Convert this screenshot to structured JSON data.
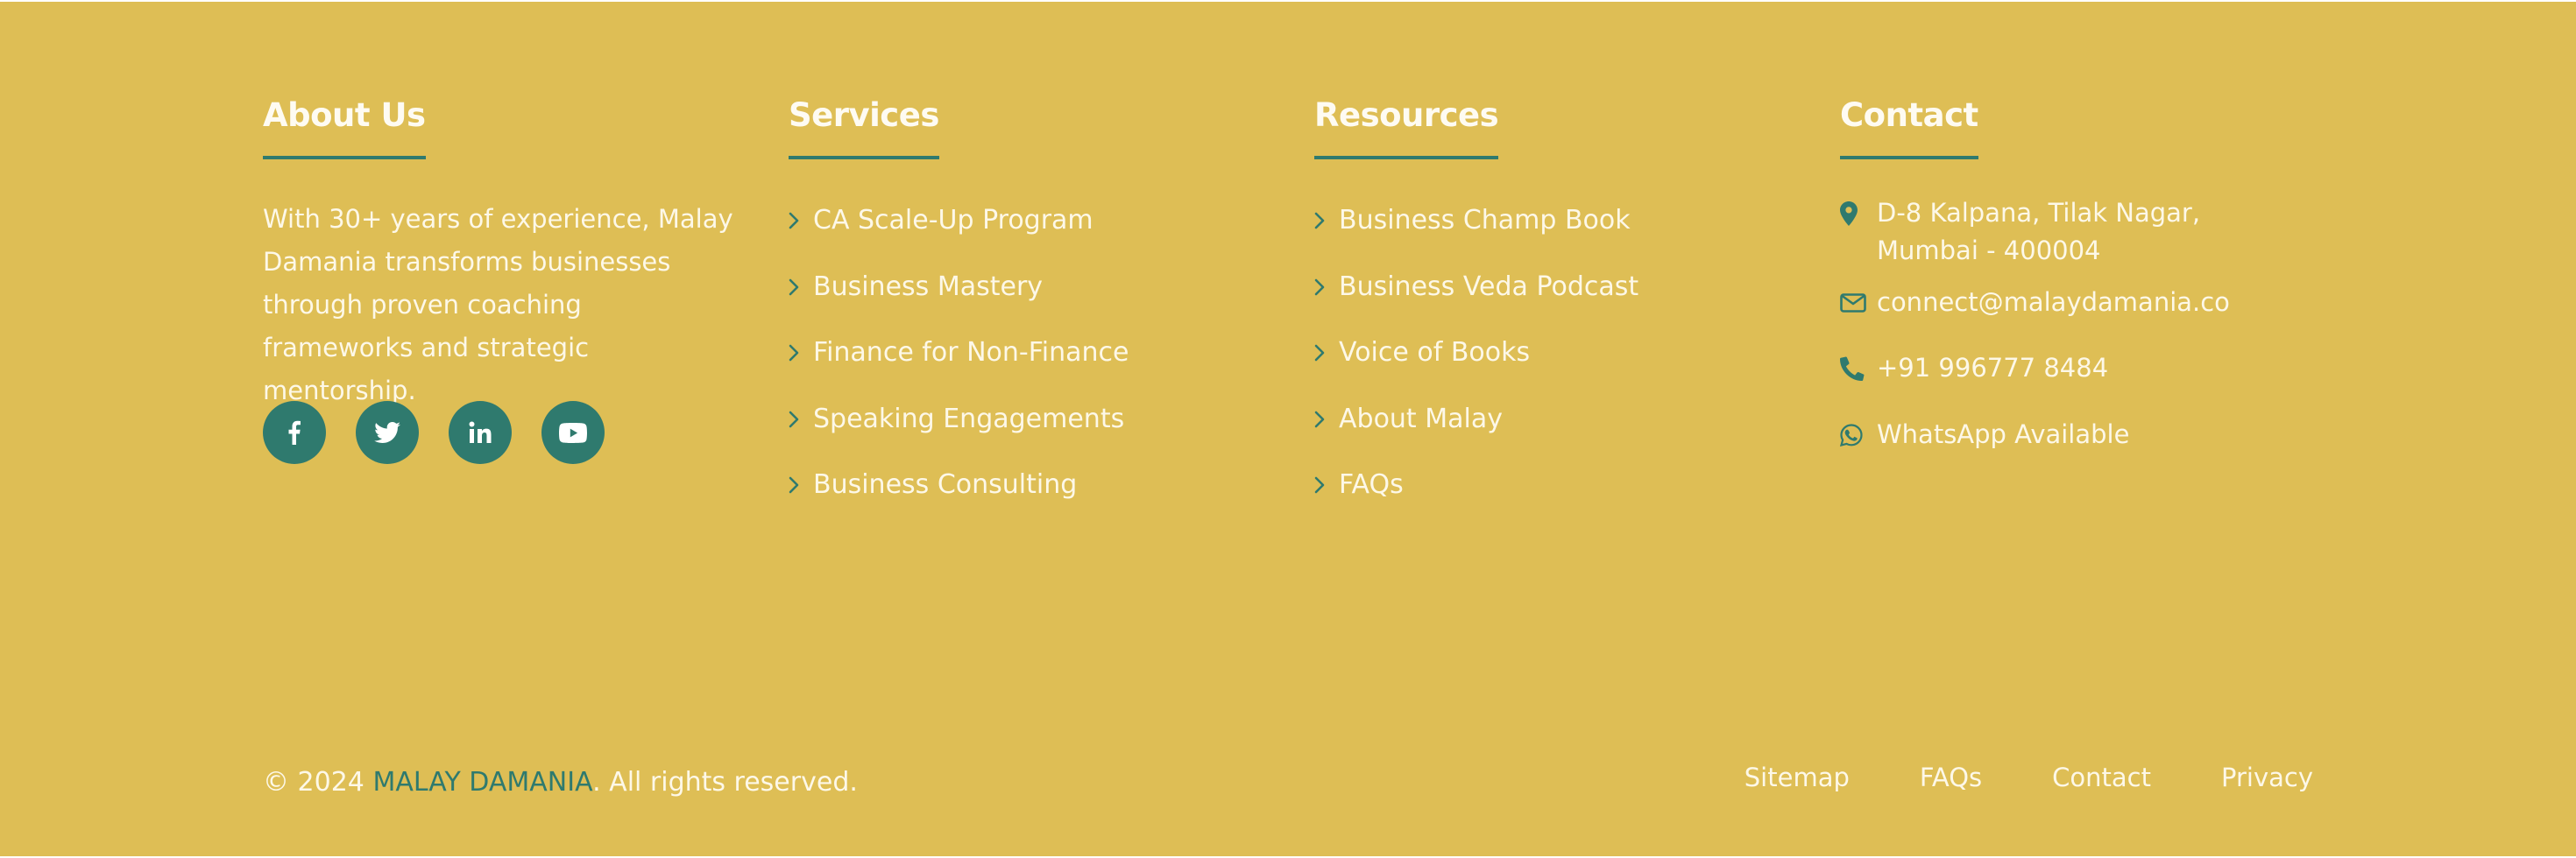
{
  "about": {
    "heading": "About Us",
    "text": "With 30+ years of experience, Malay Damania transforms businesses through proven coaching frameworks and strategic mentorship.",
    "socials": [
      "facebook-icon",
      "twitter-icon",
      "linkedin-icon",
      "youtube-icon"
    ]
  },
  "services": {
    "heading": "Services",
    "items": [
      {
        "label": "CA Scale-Up Program"
      },
      {
        "label": "Business Mastery"
      },
      {
        "label": "Finance for Non-Finance"
      },
      {
        "label": "Speaking Engagements"
      },
      {
        "label": "Business Consulting"
      }
    ]
  },
  "resources": {
    "heading": "Resources",
    "items": [
      {
        "label": "Business Champ Book"
      },
      {
        "label": "Business Veda Podcast"
      },
      {
        "label": "Voice of Books"
      },
      {
        "label": "About Malay"
      },
      {
        "label": "FAQs"
      }
    ]
  },
  "contact": {
    "heading": "Contact",
    "address": "D-8 Kalpana, Tilak Nagar, Mumbai - 400004",
    "email": "connect@malaydamania.co",
    "phone": "+91 996777 8484",
    "whatsapp": "WhatsApp Available"
  },
  "bottom": {
    "copyright_prefix": "© 2024",
    "brand": "MALAY DAMANIA",
    "copyright_suffix": ". All rights reserved.",
    "links": [
      "Sitemap",
      "FAQs",
      "Contact",
      "Privacy"
    ]
  },
  "colors": {
    "background": "#debe55",
    "accent": "#2f7a6e",
    "text": "#fdf8e8"
  }
}
